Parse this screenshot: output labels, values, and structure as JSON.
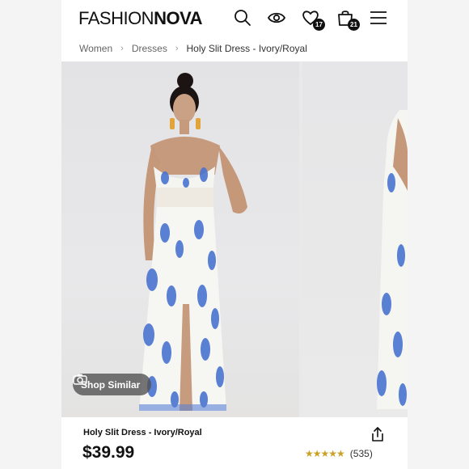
{
  "header": {
    "logo_part1": "FASHION",
    "logo_part2": "NOVA",
    "wishlist_count": "17",
    "bag_count": "21"
  },
  "breadcrumb": {
    "items": [
      "Women",
      "Dresses"
    ],
    "current": "Holy Slit Dress - Ivory/Royal"
  },
  "gallery": {
    "shop_similar_label": "Shop Similar"
  },
  "product": {
    "title": "Holy Slit Dress - Ivory/Royal",
    "price": "$39.99",
    "rating_stars": "★★★★★",
    "review_count": "(535)"
  },
  "colors": {
    "accent_star": "#c9a227",
    "dress_print": "#4a74d0"
  }
}
